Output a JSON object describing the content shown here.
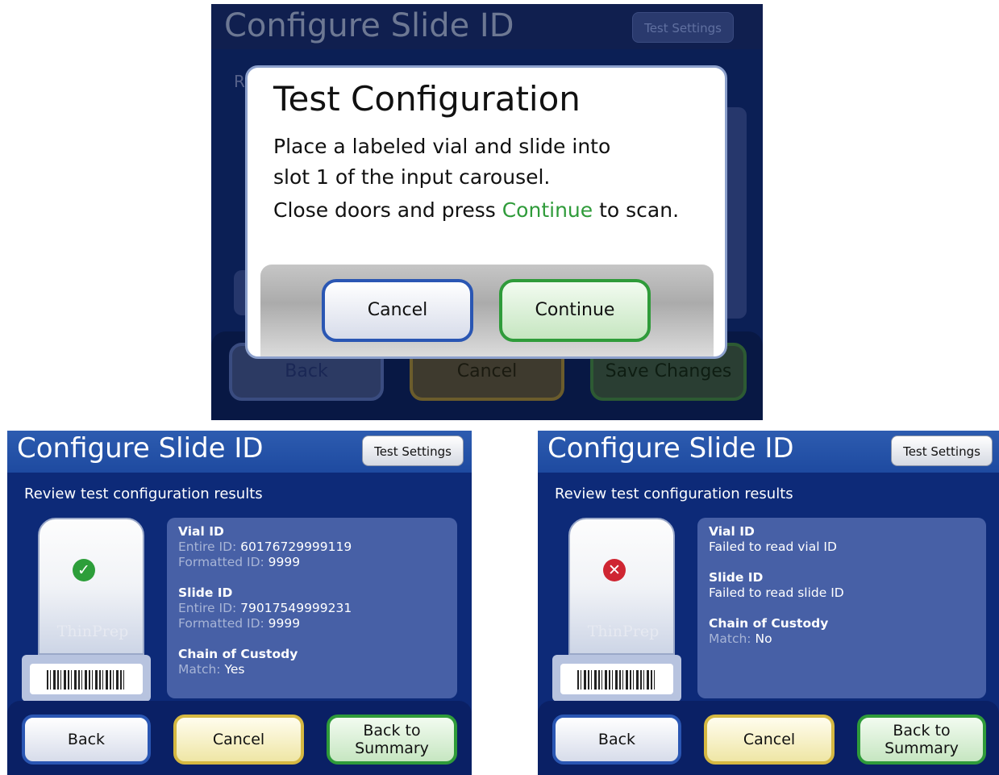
{
  "top_screen": {
    "title": "Configure Slide ID",
    "test_settings": "Test Settings",
    "hidden_instruction_char": "R",
    "buttons": {
      "back": "Back",
      "cancel": "Cancel",
      "save": "Save Changes"
    },
    "dialog": {
      "title": "Test Configuration",
      "line1": "Place a labeled vial and slide into",
      "line2": "slot 1 of the input carousel.",
      "line3_pre": "Close doors and press ",
      "line3_link": "Continue",
      "line3_post": " to scan.",
      "cancel": "Cancel",
      "continue": "Continue"
    }
  },
  "success_screen": {
    "title": "Configure Slide ID",
    "test_settings": "Test Settings",
    "instruction": "Review test configuration results",
    "status_icon": "checkmark-icon",
    "vial_brand": "ThinPrep",
    "vial": {
      "label": "Vial ID",
      "entire_label": "Entire ID:",
      "entire": "60176729999119",
      "formatted_label": "Formatted ID:",
      "formatted": "9999"
    },
    "slide": {
      "label": "Slide ID",
      "entire_label": "Entire ID:",
      "entire": "79017549999231",
      "formatted_label": "Formatted ID:",
      "formatted": "9999"
    },
    "custody": {
      "label": "Chain of Custody",
      "match_label": "Match:",
      "match": "Yes"
    },
    "buttons": {
      "back": "Back",
      "cancel": "Cancel",
      "summary_1": "Back to",
      "summary_2": "Summary"
    }
  },
  "fail_screen": {
    "title": "Configure Slide ID",
    "test_settings": "Test Settings",
    "instruction": "Review test configuration results",
    "status_icon": "error-x-icon",
    "vial_brand": "ThinPrep",
    "vial": {
      "label": "Vial ID",
      "message": "Failed to read vial ID"
    },
    "slide": {
      "label": "Slide ID",
      "message": "Failed to read slide ID"
    },
    "custody": {
      "label": "Chain of Custody",
      "match_label": "Match:",
      "match": "No"
    },
    "buttons": {
      "back": "Back",
      "cancel": "Cancel",
      "summary_1": "Back to",
      "summary_2": "Summary"
    }
  },
  "colors": {
    "screen_bg": "#0d2a78",
    "header": "#1e4aa0",
    "info_panel": "#4760a6",
    "green": "#2f9b3a",
    "yellow": "#d5b842",
    "blue": "#2a56b3",
    "error": "#cf2632"
  }
}
